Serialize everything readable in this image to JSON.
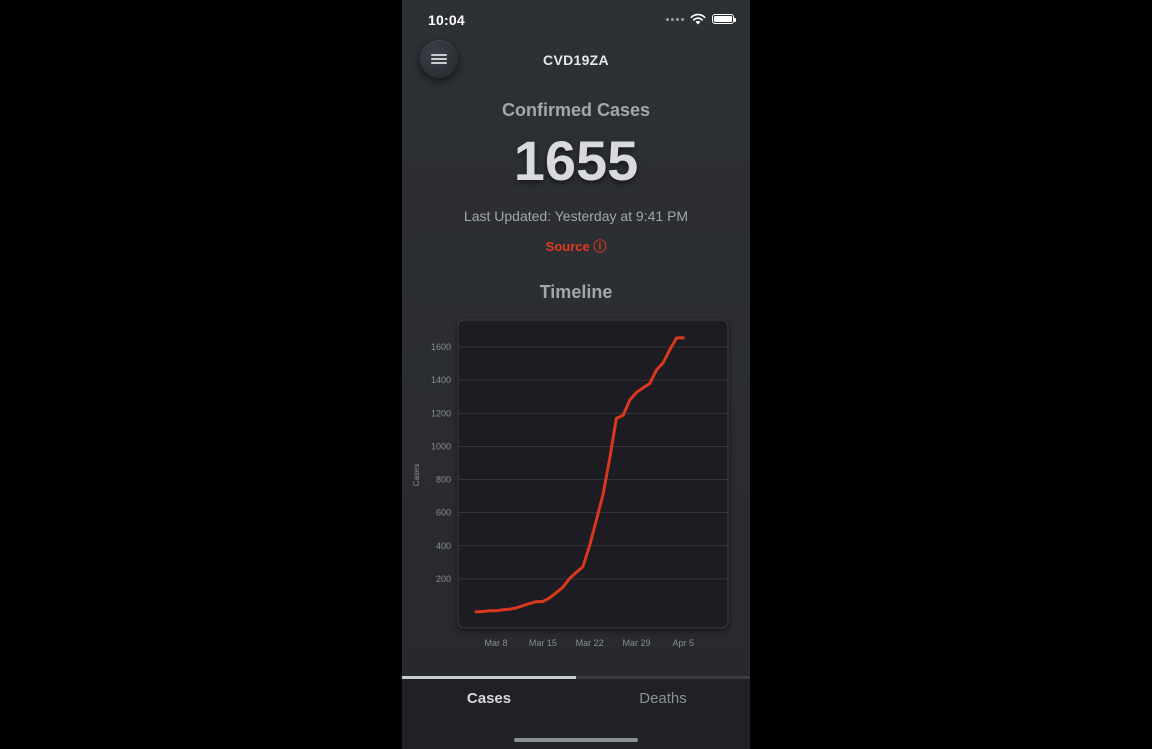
{
  "status_bar": {
    "time": "10:04"
  },
  "header": {
    "app_title": "CVD19ZA"
  },
  "summary": {
    "section_title": "Confirmed Cases",
    "count": "1655",
    "last_updated": "Last Updated: Yesterday at 9:41 PM",
    "source_label": "Source ⓘ"
  },
  "timeline": {
    "title": "Timeline"
  },
  "colors": {
    "accent": "#e03a1f",
    "background": "#2b2d32",
    "chart_bg": "#1d1e21"
  },
  "chart_data": {
    "type": "line",
    "title": "",
    "ylabel": "Cases",
    "xlabel": "",
    "ylim": [
      0,
      1700
    ],
    "xlim": [
      5,
      40
    ],
    "yticks": [
      200,
      400,
      600,
      800,
      1000,
      1200,
      1400,
      1600
    ],
    "xticks": [
      {
        "x": 8,
        "label": "Mar 8"
      },
      {
        "x": 15,
        "label": "Mar 15"
      },
      {
        "x": 22,
        "label": "Mar 22"
      },
      {
        "x": 29,
        "label": "Mar 29"
      },
      {
        "x": 36,
        "label": "Apr 5"
      }
    ],
    "grid": true,
    "series": [
      {
        "color": "#d9381e",
        "x": [
          5,
          6,
          7,
          8,
          9,
          10,
          11,
          12,
          13,
          14,
          15,
          16,
          17,
          18,
          19,
          20,
          21,
          22,
          23,
          24,
          25,
          26,
          27,
          28,
          29,
          30,
          31,
          32,
          33,
          34,
          35,
          36
        ],
        "y": [
          1,
          3,
          7,
          7,
          13,
          17,
          24,
          38,
          51,
          62,
          64,
          85,
          116,
          150,
          202,
          240,
          274,
          402,
          554,
          709,
          927,
          1170,
          1187,
          1280,
          1326,
          1353,
          1380,
          1462,
          1505,
          1585,
          1655,
          1655
        ]
      }
    ]
  },
  "tabs": [
    {
      "label": "Cases",
      "active": true
    },
    {
      "label": "Deaths",
      "active": false
    }
  ]
}
